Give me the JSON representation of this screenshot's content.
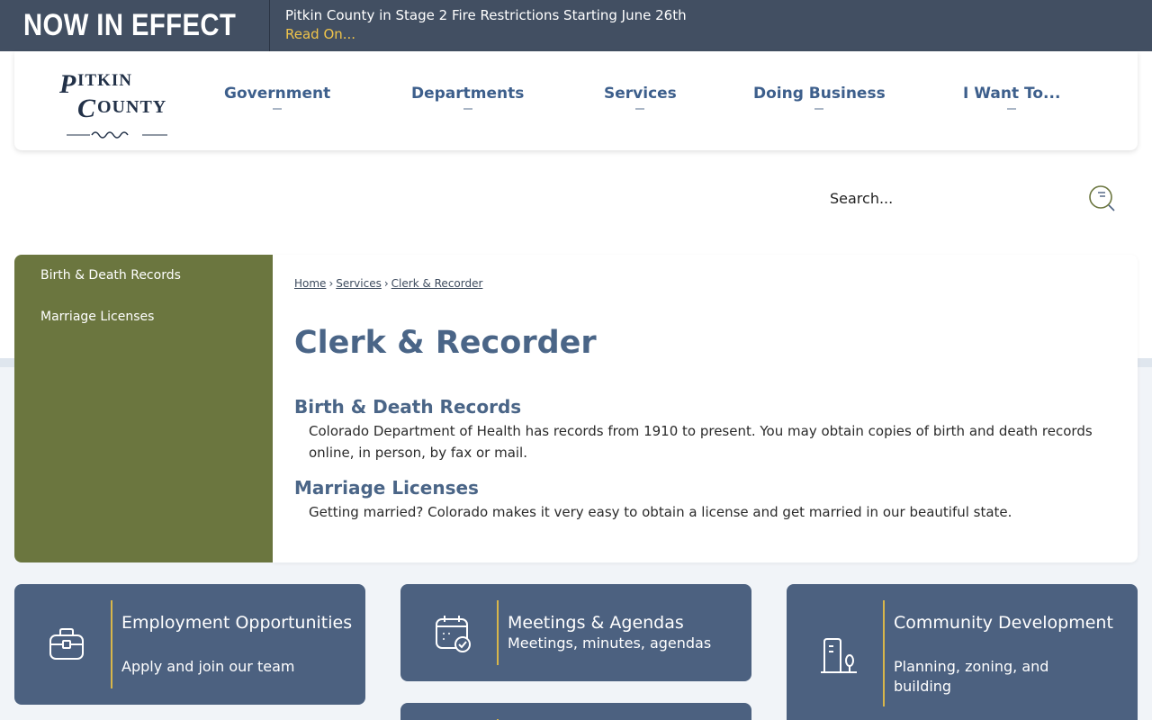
{
  "alert": {
    "label": "NOW IN EFFECT",
    "title": "Pitkin County in Stage 2 Fire Restrictions Starting June 26th",
    "link": "Read On..."
  },
  "logo": {
    "line1": "PITKIN",
    "line2": "COUNTY"
  },
  "nav": [
    "Government",
    "Departments",
    "Services",
    "Doing Business",
    "I Want To..."
  ],
  "search": {
    "placeholder": "Search..."
  },
  "sidebar": {
    "items": [
      {
        "label": "Birth & Death Records"
      },
      {
        "label": "Marriage Licenses"
      }
    ]
  },
  "breadcrumb": {
    "items": [
      "Home",
      "Services",
      "Clerk & Recorder"
    ],
    "separator": "›"
  },
  "page": {
    "title": "Clerk & Recorder",
    "sections": [
      {
        "title": "Birth & Death Records",
        "description": "Colorado Department of Health has records from 1910 to present. You may obtain copies of birth and death records online, in person, by fax or mail."
      },
      {
        "title": "Marriage Licenses",
        "description": "Getting married? Colorado makes it very easy to obtain a license and get married in our beautiful state."
      }
    ]
  },
  "tiles": [
    {
      "title": "Employment Opportunities",
      "subtitle": "Apply and join our team",
      "icon": "briefcase-icon"
    },
    {
      "title": "Meetings & Agendas",
      "subtitle": "Meetings, minutes, agendas",
      "icon": "calendar-check-icon"
    },
    {
      "title": "Community Development",
      "subtitle": "Planning, zoning, and building",
      "icon": "building-icon"
    }
  ],
  "colors": {
    "alert_bg": "#424f62",
    "alert_link": "#f0c44a",
    "nav_text": "#3d5f8c",
    "sidebar_bg": "#6b763f",
    "heading": "#4a6587",
    "tile_bg": "#4c6180",
    "tile_accent": "#d8b64a"
  }
}
